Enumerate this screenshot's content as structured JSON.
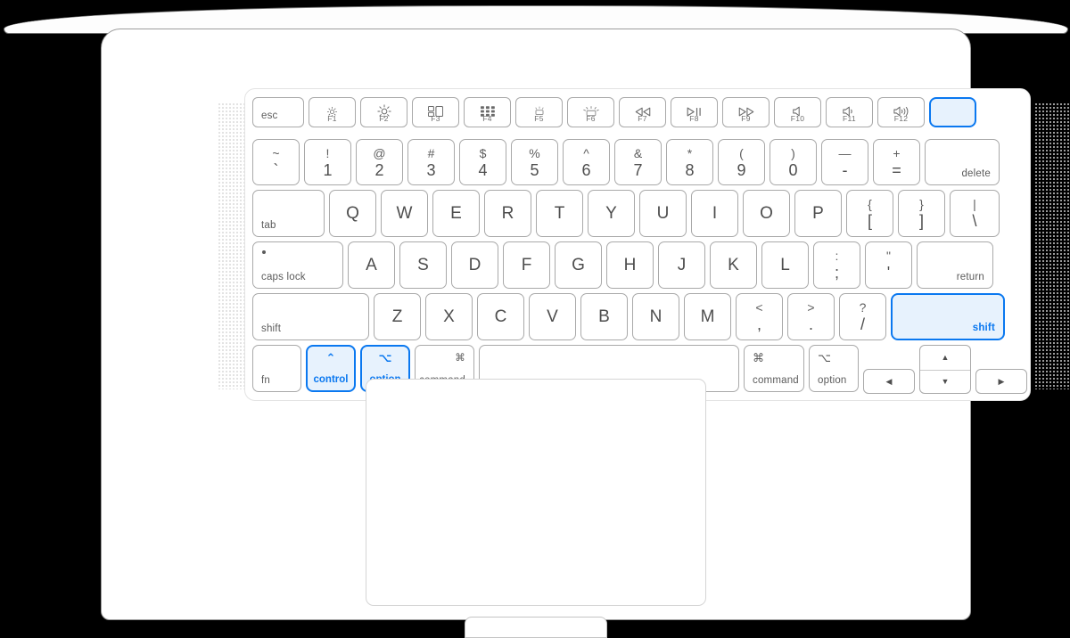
{
  "device": {
    "name": "macbook-laptop",
    "accent_color": "#0a78f0",
    "highlight_fill": "#e7f2fd",
    "key_border_color": "#a9a9a9",
    "key_text_color": "#5b5b5b"
  },
  "keyboard": {
    "function_row": [
      {
        "id": "esc",
        "label": "esc",
        "align": "left",
        "width": "w-esc"
      },
      {
        "id": "f1",
        "fkey": "F1",
        "icon": "brightness-down-icon"
      },
      {
        "id": "f2",
        "fkey": "F2",
        "icon": "brightness-up-icon"
      },
      {
        "id": "f3",
        "fkey": "F3",
        "icon": "mission-control-icon"
      },
      {
        "id": "f4",
        "fkey": "F4",
        "icon": "launchpad-icon"
      },
      {
        "id": "f5",
        "fkey": "F5",
        "icon": "keyboard-backlight-down-icon"
      },
      {
        "id": "f6",
        "fkey": "F6",
        "icon": "keyboard-backlight-up-icon"
      },
      {
        "id": "f7",
        "fkey": "F7",
        "icon": "rewind-icon"
      },
      {
        "id": "f8",
        "fkey": "F8",
        "icon": "play-pause-icon"
      },
      {
        "id": "f9",
        "fkey": "F9",
        "icon": "fast-forward-icon"
      },
      {
        "id": "f10",
        "fkey": "F10",
        "icon": "mute-icon"
      },
      {
        "id": "f11",
        "fkey": "F11",
        "icon": "volume-down-icon"
      },
      {
        "id": "f12",
        "fkey": "F12",
        "icon": "volume-up-icon"
      },
      {
        "id": "touch-id",
        "label": "",
        "highlighted": true,
        "icon": "touch-id-power-icon"
      }
    ],
    "number_row": [
      {
        "id": "backtick",
        "top": "~",
        "bottom": "`"
      },
      {
        "id": "one",
        "top": "!",
        "bottom": "1"
      },
      {
        "id": "two",
        "top": "@",
        "bottom": "2"
      },
      {
        "id": "three",
        "top": "#",
        "bottom": "3"
      },
      {
        "id": "four",
        "top": "$",
        "bottom": "4"
      },
      {
        "id": "five",
        "top": "%",
        "bottom": "5"
      },
      {
        "id": "six",
        "top": "^",
        "bottom": "6"
      },
      {
        "id": "seven",
        "top": "&",
        "bottom": "7"
      },
      {
        "id": "eight",
        "top": "*",
        "bottom": "8"
      },
      {
        "id": "nine",
        "top": "(",
        "bottom": "9"
      },
      {
        "id": "zero",
        "top": ")",
        "bottom": "0"
      },
      {
        "id": "minus",
        "top": "—",
        "bottom": "-"
      },
      {
        "id": "equal",
        "top": "+",
        "bottom": "="
      },
      {
        "id": "delete",
        "label": "delete",
        "align": "right",
        "width": "w-delete"
      }
    ],
    "qwerty_row": [
      {
        "id": "tab",
        "label": "tab",
        "align": "left",
        "width": "w-tab"
      },
      {
        "id": "q",
        "glyph": "Q"
      },
      {
        "id": "w",
        "glyph": "W"
      },
      {
        "id": "e",
        "glyph": "E"
      },
      {
        "id": "r",
        "glyph": "R"
      },
      {
        "id": "t",
        "glyph": "T"
      },
      {
        "id": "y",
        "glyph": "Y"
      },
      {
        "id": "u",
        "glyph": "U"
      },
      {
        "id": "i",
        "glyph": "I"
      },
      {
        "id": "o",
        "glyph": "O"
      },
      {
        "id": "p",
        "glyph": "P"
      },
      {
        "id": "bracket-left",
        "top": "{",
        "bottom": "["
      },
      {
        "id": "bracket-right",
        "top": "}",
        "bottom": "]"
      },
      {
        "id": "backslash",
        "top": "|",
        "bottom": "\\",
        "width": "w-backsl"
      }
    ],
    "home_row": [
      {
        "id": "caps-lock",
        "label": "caps lock",
        "align": "left",
        "width": "w-caps",
        "indicator": true
      },
      {
        "id": "a",
        "glyph": "A"
      },
      {
        "id": "s",
        "glyph": "S"
      },
      {
        "id": "d",
        "glyph": "D"
      },
      {
        "id": "f",
        "glyph": "F"
      },
      {
        "id": "g",
        "glyph": "G"
      },
      {
        "id": "h",
        "glyph": "H"
      },
      {
        "id": "j",
        "glyph": "J"
      },
      {
        "id": "k",
        "glyph": "K"
      },
      {
        "id": "l",
        "glyph": "L"
      },
      {
        "id": "semicolon",
        "top": ":",
        "bottom": ";"
      },
      {
        "id": "quote",
        "top": "\"",
        "bottom": "'"
      },
      {
        "id": "return",
        "label": "return",
        "align": "right",
        "width": "w-return"
      }
    ],
    "shift_row": [
      {
        "id": "shift-left",
        "label": "shift",
        "align": "left",
        "width": "w-lshift"
      },
      {
        "id": "z",
        "glyph": "Z"
      },
      {
        "id": "x",
        "glyph": "X"
      },
      {
        "id": "c",
        "glyph": "C"
      },
      {
        "id": "v",
        "glyph": "V"
      },
      {
        "id": "b",
        "glyph": "B"
      },
      {
        "id": "n",
        "glyph": "N"
      },
      {
        "id": "m",
        "glyph": "M"
      },
      {
        "id": "comma",
        "top": "<",
        "bottom": ","
      },
      {
        "id": "period",
        "top": ">",
        "bottom": "."
      },
      {
        "id": "slash",
        "top": "?",
        "bottom": "/"
      },
      {
        "id": "shift-right",
        "label": "shift",
        "align": "right",
        "width": "w-rshift",
        "highlighted": true
      }
    ],
    "bottom_row": [
      {
        "id": "fn",
        "label": "fn",
        "align": "left",
        "width": "w-fn"
      },
      {
        "id": "control",
        "label": "control",
        "symbol": "⌃",
        "width": "w-ctrl",
        "highlighted": true
      },
      {
        "id": "option-left",
        "label": "option",
        "symbol": "⌥",
        "width": "w-opt",
        "highlighted": true
      },
      {
        "id": "command-left",
        "label": "command",
        "symbol": "⌘",
        "width": "w-cmd",
        "align": "right"
      },
      {
        "id": "space",
        "label": "",
        "width": "w-space"
      },
      {
        "id": "command-right",
        "label": "command",
        "symbol": "⌘",
        "width": "w-cmdr",
        "align": "left"
      },
      {
        "id": "option-right",
        "label": "option",
        "symbol": "⌥",
        "width": "w-optr",
        "align": "left"
      }
    ],
    "arrow_keys": {
      "left": {
        "id": "arrow-left",
        "glyph": "◀"
      },
      "up": {
        "id": "arrow-up",
        "glyph": "▲"
      },
      "down": {
        "id": "arrow-down",
        "glyph": "▼"
      },
      "right": {
        "id": "arrow-right",
        "glyph": "▶"
      }
    }
  },
  "trackpad": {
    "name": "trackpad"
  },
  "highlighted_keys": [
    "control",
    "option-left",
    "shift-right",
    "touch-id"
  ]
}
